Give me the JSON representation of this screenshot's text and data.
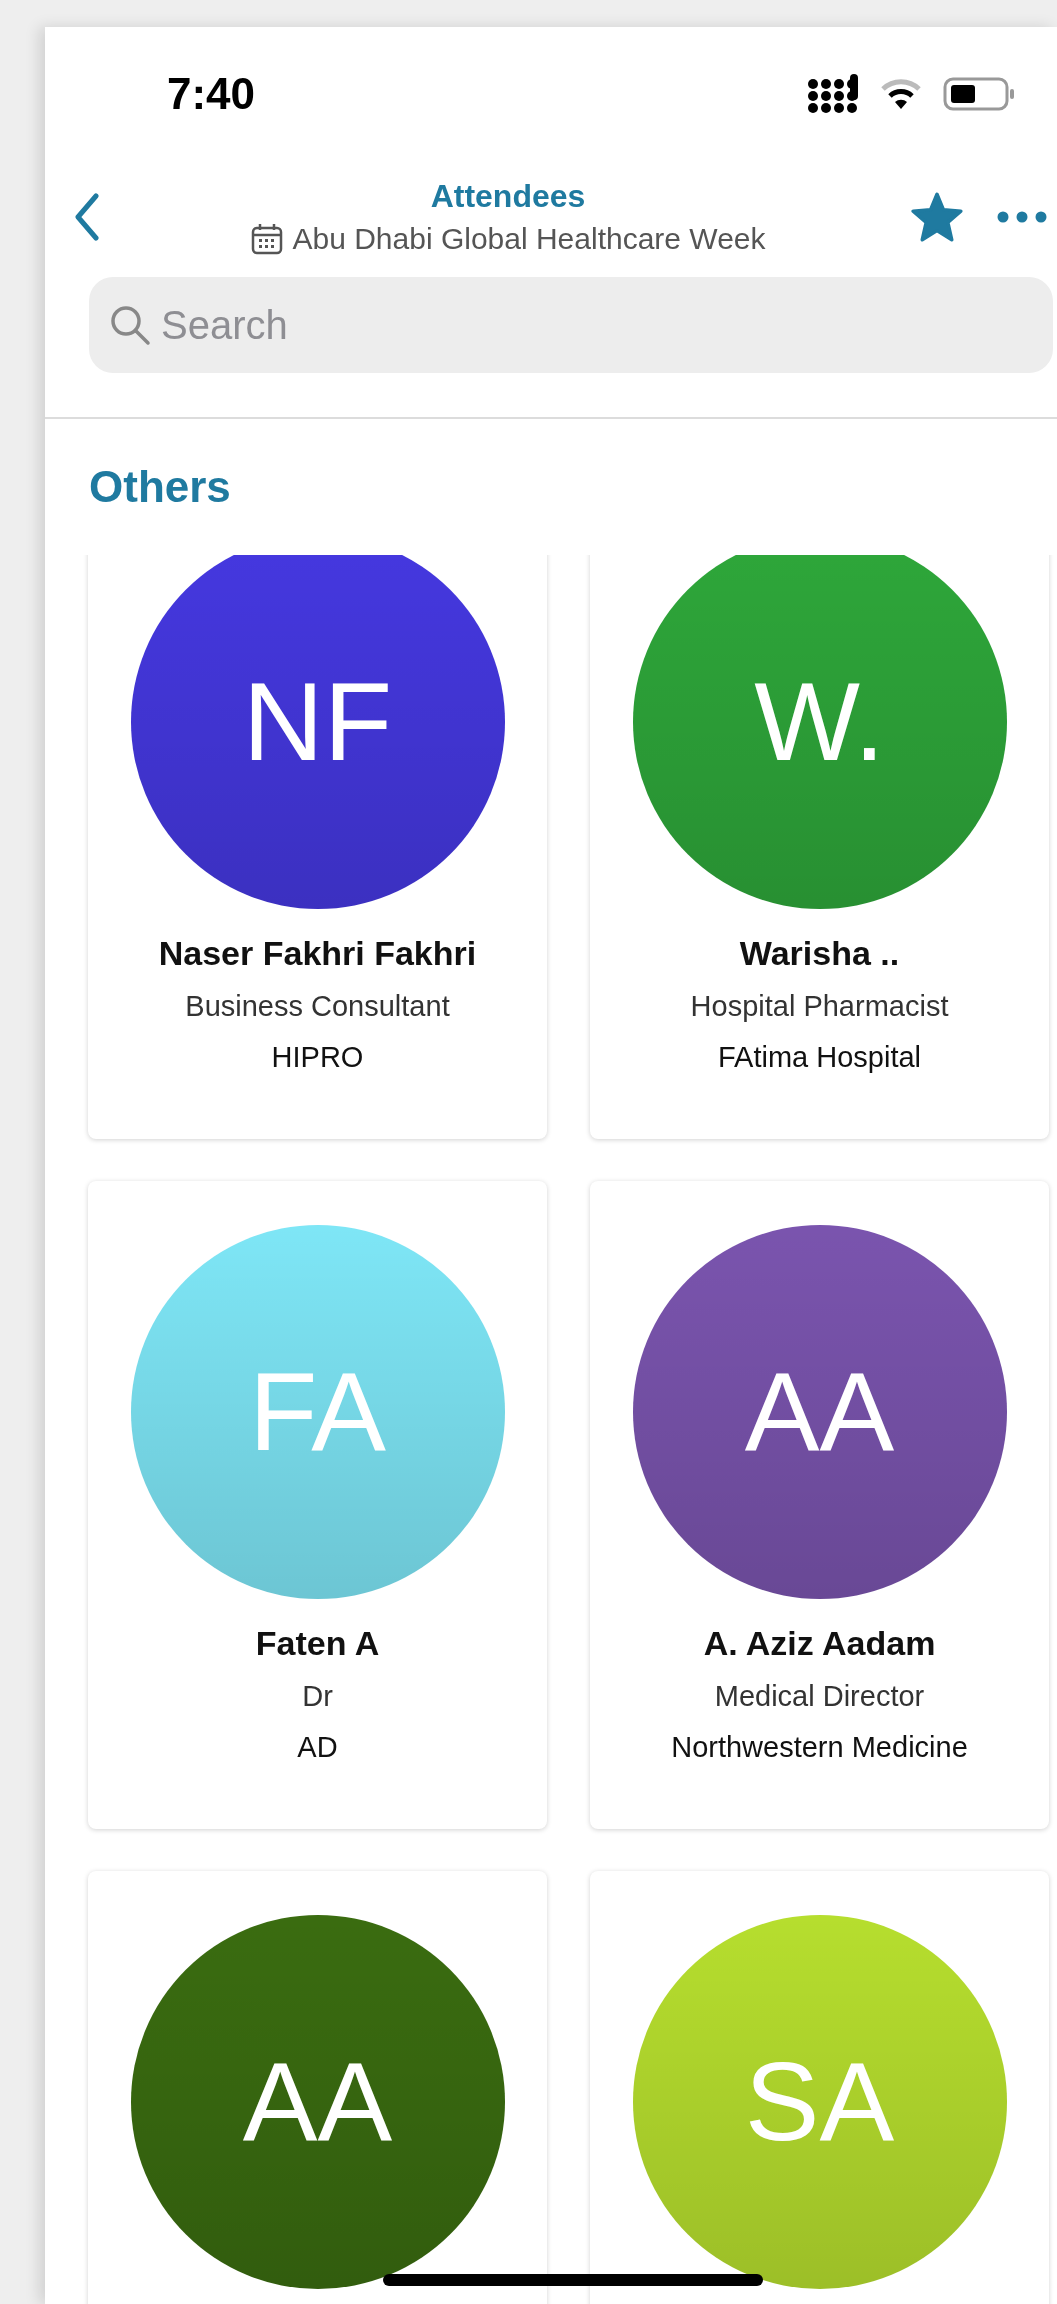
{
  "status_bar": {
    "time": "7:40"
  },
  "header": {
    "title": "Attendees",
    "subtitle": "Abu Dhabi Global Healthcare Week",
    "favorite": true
  },
  "search": {
    "placeholder": "Search"
  },
  "section": {
    "title": "Others"
  },
  "attendees": [
    {
      "initials": "NF",
      "name": "Naser Fakhri Fakhri",
      "title": "Business Consultant",
      "organization": "HIPRO",
      "color": "#4538e0"
    },
    {
      "initials": "W.",
      "name": "Warisha ..",
      "title": "Hospital Pharmacist",
      "organization": "FAtima Hospital",
      "color": "#2ea73a"
    },
    {
      "initials": "FA",
      "name": "Faten A",
      "title": "Dr",
      "organization": "AD",
      "color": "#7ee6f6"
    },
    {
      "initials": "AA",
      "name": "A. Aziz Aadam",
      "title": "Medical Director",
      "organization": "Northwestern Medicine",
      "color": "#7a54ae"
    },
    {
      "initials": "AA",
      "color": "#3a6c10"
    },
    {
      "initials": "SA",
      "color": "#b6de2e"
    }
  ]
}
